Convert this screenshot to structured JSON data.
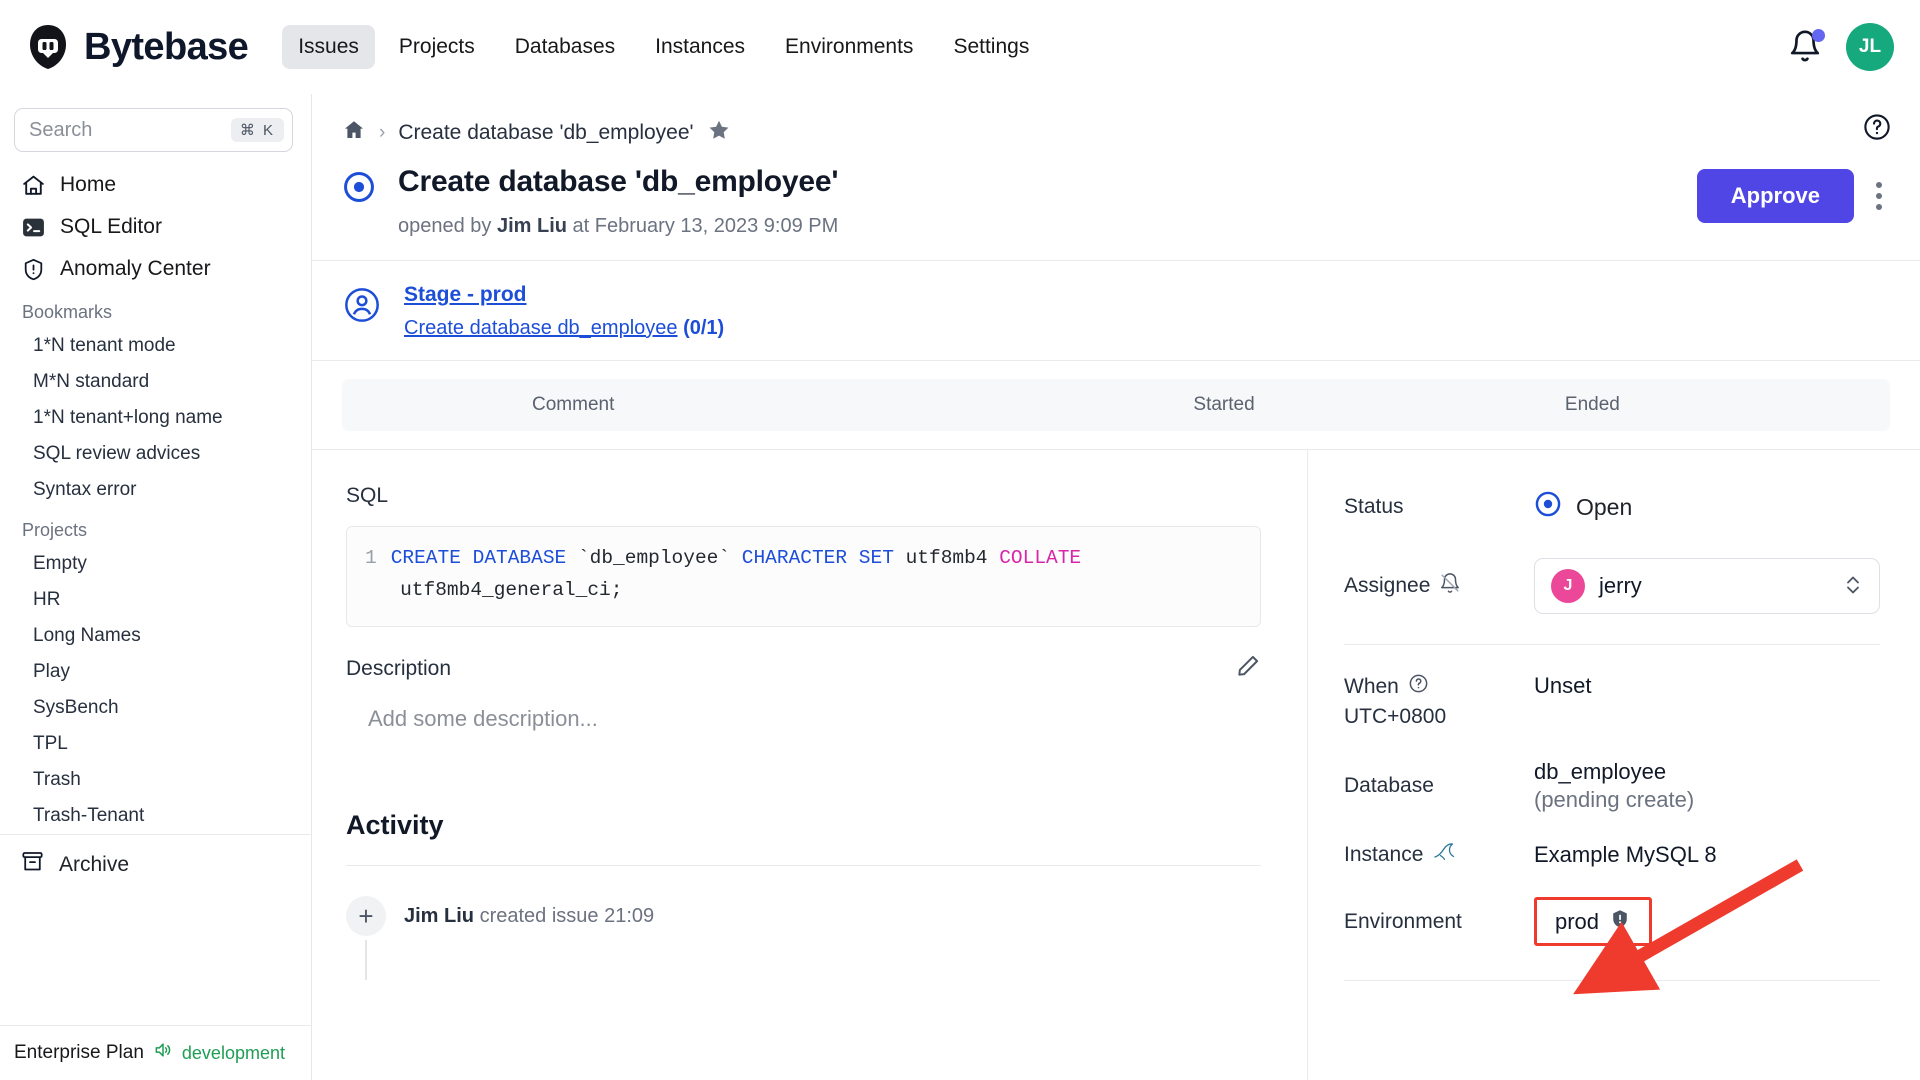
{
  "brand": {
    "name": "Bytebase",
    "logo_icon": "bytebase-logo"
  },
  "topnav": {
    "items": [
      {
        "label": "Issues",
        "active": true
      },
      {
        "label": "Projects",
        "active": false
      },
      {
        "label": "Databases",
        "active": false
      },
      {
        "label": "Instances",
        "active": false
      },
      {
        "label": "Environments",
        "active": false
      },
      {
        "label": "Settings",
        "active": false
      }
    ],
    "notification_icon": "bell-icon",
    "avatar_initials": "JL"
  },
  "sidebar": {
    "search": {
      "placeholder": "Search",
      "shortcut": "⌘ K"
    },
    "links": [
      {
        "label": "Home",
        "icon": "home-icon"
      },
      {
        "label": "SQL Editor",
        "icon": "terminal-icon"
      },
      {
        "label": "Anomaly Center",
        "icon": "shield-alert-icon"
      }
    ],
    "bookmarks_heading": "Bookmarks",
    "bookmarks": [
      "1*N tenant mode",
      "M*N standard",
      "1*N tenant+long name",
      "SQL review advices",
      "Syntax error"
    ],
    "projects_heading": "Projects",
    "projects": [
      "Empty",
      "HR",
      "Long Names",
      "Play",
      "SysBench",
      "TPL",
      "Trash",
      "Trash-Tenant"
    ],
    "archive": {
      "label": "Archive",
      "icon": "archive-icon"
    },
    "footer": {
      "plan": "Enterprise Plan",
      "mode": "development",
      "icon": "speaker-icon"
    }
  },
  "breadcrumb": {
    "home_icon": "home-icon",
    "separator": "›",
    "current": "Create database 'db_employee'",
    "star_icon": "star-icon"
  },
  "help_icon": "question-circle-icon",
  "issue": {
    "status_icon": "open-circle-icon",
    "title": "Create database 'db_employee'",
    "meta_prefix": "opened by ",
    "author": "Jim Liu",
    "meta_suffix": " at February 13, 2023 9:09 PM",
    "approve_label": "Approve",
    "kebab_icon": "more-vertical-icon"
  },
  "stage": {
    "avatar_icon": "user-circle-icon",
    "name": "Stage - prod",
    "task_name": "Create database db_employee",
    "task_count": "(0/1)"
  },
  "task_table": {
    "columns": [
      "Comment",
      "Started",
      "Ended"
    ]
  },
  "sql": {
    "label": "SQL",
    "line_number": "1",
    "tokens": [
      {
        "t": "CREATE DATABASE",
        "c": "kw"
      },
      {
        "t": " `db_employee` ",
        "c": ""
      },
      {
        "t": "CHARACTER SET",
        "c": "kw"
      },
      {
        "t": " utf8mb4 ",
        "c": ""
      },
      {
        "t": "COLLATE",
        "c": "kw2"
      },
      {
        "t": "\nutf8mb4_general_ci;",
        "c": ""
      }
    ],
    "full_text": "CREATE DATABASE `db_employee` CHARACTER SET utf8mb4 COLLATE utf8mb4_general_ci;"
  },
  "description": {
    "label": "Description",
    "edit_icon": "pencil-icon",
    "placeholder": "Add some description..."
  },
  "activity": {
    "title": "Activity",
    "items": [
      {
        "icon": "plus-icon",
        "actor": "Jim Liu",
        "text": " created issue 21:09"
      }
    ]
  },
  "details": {
    "status": {
      "label": "Status",
      "value": "Open",
      "icon": "open-circle-icon"
    },
    "assignee": {
      "label": "Assignee",
      "bell_icon": "bell-slash-icon",
      "avatar_initial": "J",
      "value": "jerry",
      "caret_icon": "chevron-updown-icon"
    },
    "when": {
      "label": "When",
      "help_icon": "question-circle-icon",
      "timezone": "UTC+0800",
      "value": "Unset"
    },
    "database": {
      "label": "Database",
      "value": "db_employee",
      "state": "(pending create)"
    },
    "instance": {
      "label": "Instance",
      "icon": "mysql-icon",
      "value": "Example MySQL 8"
    },
    "environment": {
      "label": "Environment",
      "value": "prod",
      "icon": "shield-exclamation-icon"
    }
  },
  "annotation": {
    "type": "red-arrow",
    "highlight_color": "#ef3b2d"
  }
}
